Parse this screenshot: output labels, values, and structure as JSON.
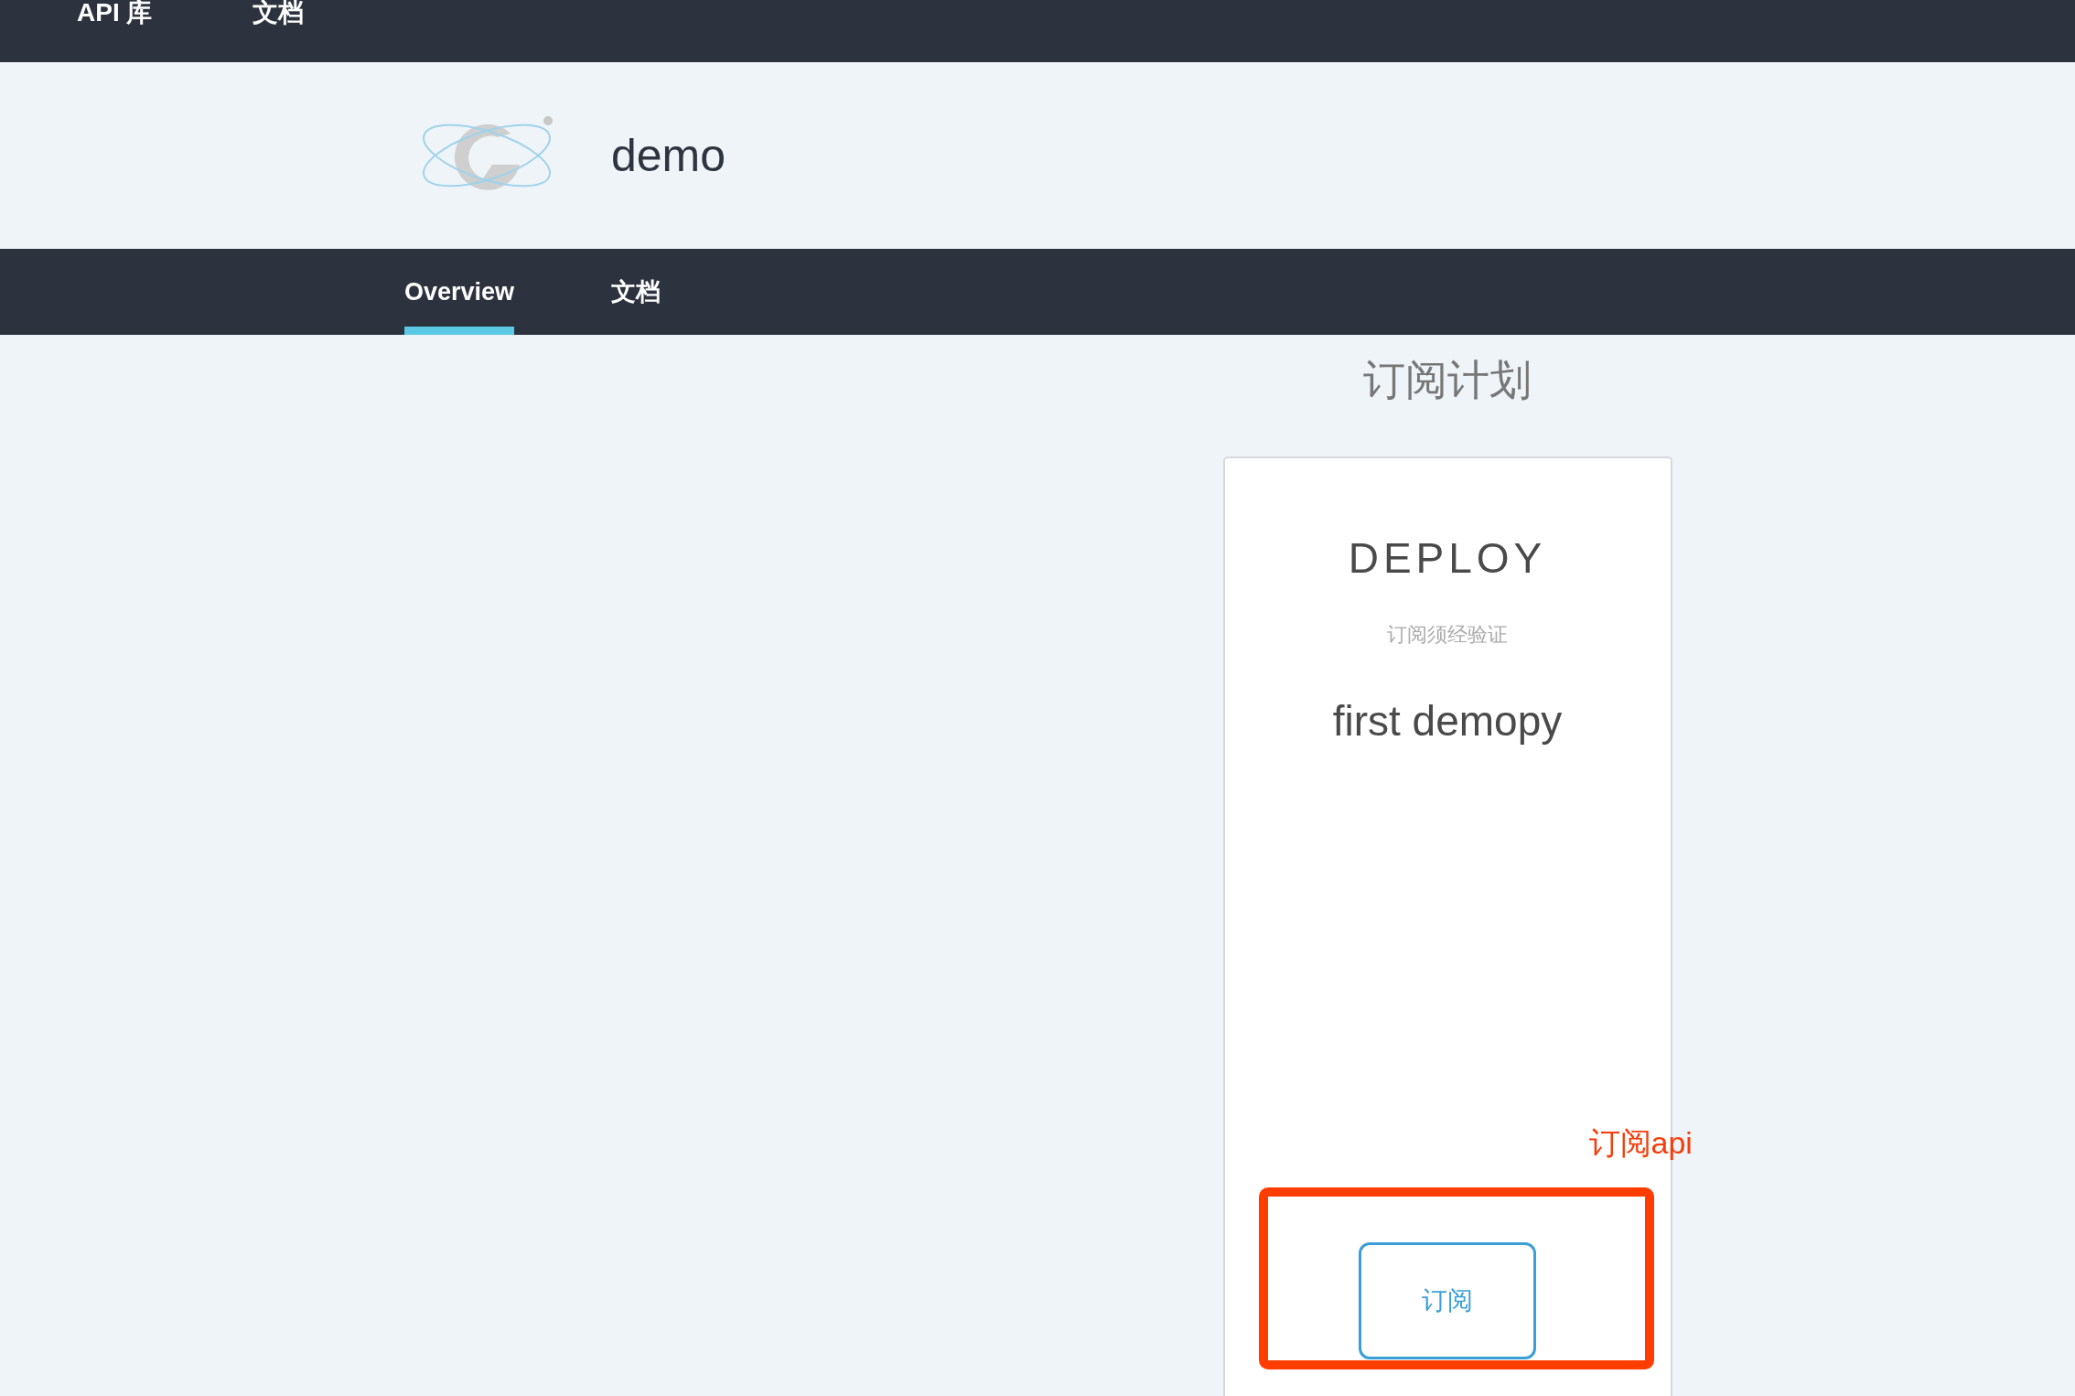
{
  "top_nav": [
    {
      "label": "API 库"
    },
    {
      "label": "文档"
    }
  ],
  "header": {
    "title": "demo"
  },
  "tabs": [
    {
      "label": "Overview",
      "selected": true
    },
    {
      "label": "文档",
      "selected": false
    }
  ],
  "section_title": "订阅计划",
  "plans": [
    {
      "name": "DEPLOY",
      "note": "订阅须经验证",
      "description": "first demopy",
      "button": "订阅"
    }
  ],
  "annotation": {
    "label": "订阅api"
  }
}
